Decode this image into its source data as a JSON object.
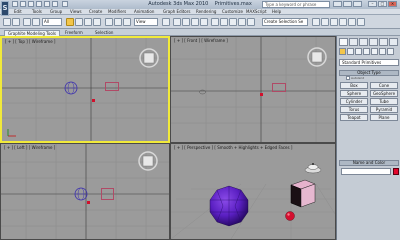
{
  "app": {
    "title": "Autodesk 3ds Max 2010",
    "file": "Primitives.max",
    "logo_letter": "S",
    "search_placeholder": "Type a keyword or phrase"
  },
  "menus": [
    "Edit",
    "Tools",
    "Group",
    "Views",
    "Create",
    "Modifiers",
    "Animation",
    "Graph Editors",
    "Rendering",
    "Customize",
    "MAXScript",
    "Help"
  ],
  "toolbar": {
    "selection_filter": "All",
    "reference_coord": "View",
    "named_selection": "Create Selection Se"
  },
  "ribbon": {
    "tabs": [
      "Graphite Modeling Tools",
      "Freeform",
      "Selection"
    ]
  },
  "viewports": {
    "top": "[ + ] [ Top ] [ Wireframe ]",
    "front": "[ + ] [ Front ] [ Wireframe ]",
    "left": "[ + ] [ Left ] [ Wireframe ]",
    "perspective": "[ + ] [ Perspective ] [ Smooth + Highlights + Edged Faces ]"
  },
  "command_panel": {
    "category": "Standard Primitives",
    "object_type_title": "Object Type",
    "autogrid_label": "AutoGrid",
    "object_buttons": [
      "Box",
      "Cone",
      "Sphere",
      "GeoSphere",
      "Cylinder",
      "Tube",
      "Torus",
      "Pyramid",
      "Teapot",
      "Plane"
    ],
    "name_color_title": "Name and Color",
    "active_color": "#e2062c"
  }
}
